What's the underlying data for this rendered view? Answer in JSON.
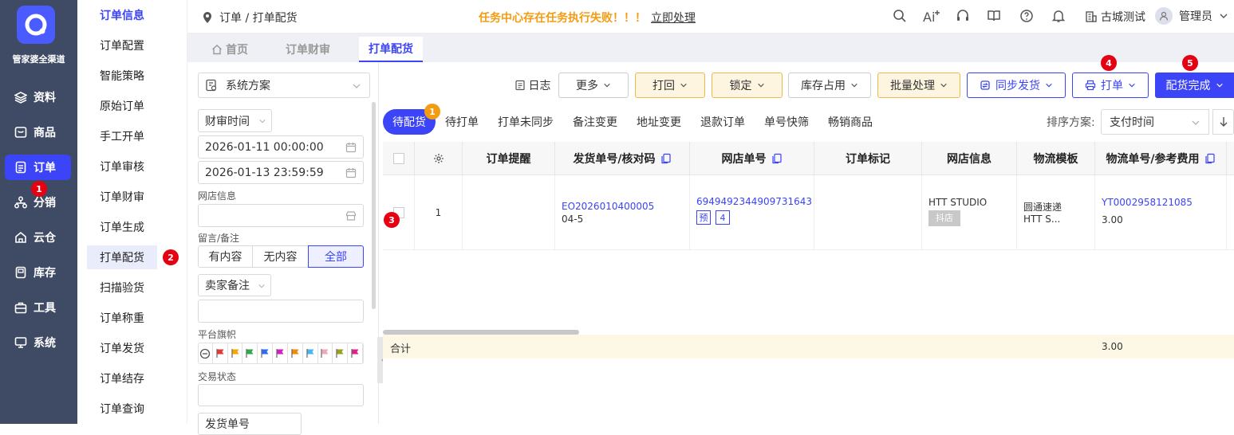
{
  "brand": "管家婆全渠道",
  "leftnav": {
    "items": [
      {
        "label": "资料",
        "icon": "layers-icon"
      },
      {
        "label": "商品",
        "icon": "box-icon"
      },
      {
        "label": "订单",
        "icon": "order-icon"
      },
      {
        "label": "分销",
        "icon": "network-icon"
      },
      {
        "label": "云仓",
        "icon": "cloud-warehouse-icon"
      },
      {
        "label": "库存",
        "icon": "inventory-icon"
      },
      {
        "label": "工具",
        "icon": "toolbox-icon"
      },
      {
        "label": "系统",
        "icon": "monitor-icon"
      }
    ],
    "active": "订单",
    "badge": "1"
  },
  "submenu": {
    "items": [
      "订单信息",
      "订单配置",
      "智能策略",
      "原始订单",
      "手工开单",
      "订单审核",
      "订单财审",
      "订单生成",
      "打单配货",
      "扫描验货",
      "订单称重",
      "订单发货",
      "订单结存",
      "订单查询"
    ],
    "active": "打单配货",
    "badge": "2"
  },
  "topbar": {
    "breadcrumb": "订单 / 打单配货",
    "alert": "任务中心存在任务执行失败！！！",
    "alert_action": "立即处理",
    "shop": "古城测试",
    "user": "管理员"
  },
  "page_tabs": [
    "首页",
    "订单财审",
    "打单配货"
  ],
  "filter": {
    "scheme": "系统方案",
    "time_type": "财审时间",
    "start_time": "2026-01-11 00:00:00",
    "end_time": "2026-01-13 23:59:59",
    "shop_label": "网店信息",
    "memo_label": "留言/备注",
    "memo_options": [
      "有内容",
      "无内容",
      "全部"
    ],
    "memo_selected": "全部",
    "seller_memo": "卖家备注",
    "flag_label": "平台旗帜",
    "flag_colors": [
      "#e53935",
      "#f5a700",
      "#2eaa4a",
      "#2a6df5",
      "#d020c0",
      "#f08a00",
      "#4ab4f0",
      "#f0a8b8",
      "#9aa020",
      "#e0208a"
    ],
    "trade_status_label": "交易状态",
    "ship_no": "发货单号"
  },
  "toolbar": {
    "log": "日志",
    "more": "更多",
    "reject": "打回",
    "lock": "锁定",
    "stock": "库存占用",
    "batch": "批量处理",
    "sync": "同步发货",
    "print": "打单",
    "print_badge": "4",
    "complete": "配货完成",
    "complete_badge": "5"
  },
  "status_tabs": {
    "items": [
      "待配货",
      "待打单",
      "打单未同步",
      "备注变更",
      "地址变更",
      "退款订单",
      "单号快筛",
      "畅销商品"
    ],
    "active": "待配货",
    "badge": "1",
    "sort_label": "排序方案:",
    "sort_value": "支付时间"
  },
  "table": {
    "headers": [
      "订单提醒",
      "发货单号/核对码",
      "网店单号",
      "订单标记",
      "网店信息",
      "物流模板",
      "物流单号/参考费用"
    ],
    "rows": [
      {
        "index": "1",
        "ship_no": "EO2026010400005",
        "check_code": "04-5",
        "shop_order": "6949492344909731643",
        "tags": [
          "预",
          "4"
        ],
        "shop_name": "HTT STUDIO",
        "platform": "抖店",
        "logistics_template": "圆通速递",
        "logistics_sub": "HTT S...",
        "tracking_no": "YT0002958121085",
        "fee": "3.00"
      }
    ],
    "checkbox_badge": "3",
    "total_label": "合计",
    "total_fee": "3.00"
  }
}
